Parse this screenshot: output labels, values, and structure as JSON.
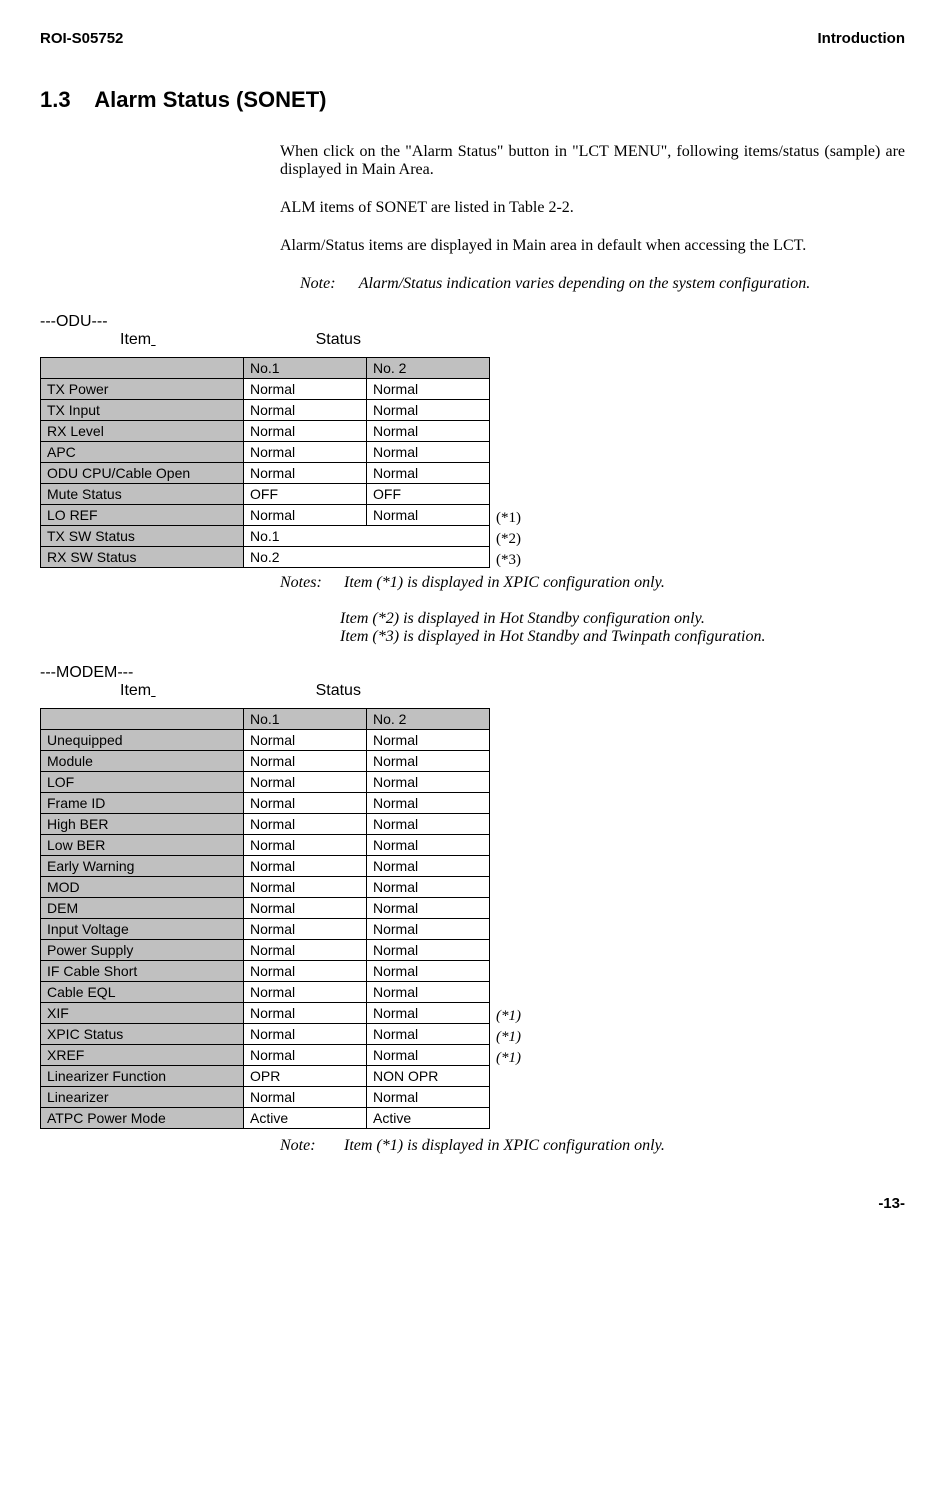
{
  "header": {
    "doc_id": "ROI-S05752",
    "section": "Introduction"
  },
  "title": {
    "num": "1.3",
    "text": "Alarm Status (SONET)"
  },
  "paras": {
    "p1": "When click on the \"Alarm Status\" button in \"LCT MENU\", following items/status (sample) are displayed in Main Area.",
    "p2": "ALM items of SONET are listed in Table 2-2.",
    "p3": "Alarm/Status items are displayed in Main area in default when accessing the LCT."
  },
  "note1": {
    "label": "Note:",
    "text": "Alarm/Status indication varies depending on the system configuration."
  },
  "labels": {
    "item": "Item",
    "status": "Status"
  },
  "odu": {
    "group": "---ODU---",
    "cols": {
      "c1": "No.1",
      "c2": "No. 2"
    },
    "rows": [
      {
        "name": "TX Power",
        "v1": "Normal",
        "v2": "Normal"
      },
      {
        "name": "TX Input",
        "v1": "Normal",
        "v2": "Normal"
      },
      {
        "name": "RX Level",
        "v1": "Normal",
        "v2": "Normal"
      },
      {
        "name": "APC",
        "v1": "Normal",
        "v2": "Normal"
      },
      {
        "name": "ODU CPU/Cable Open",
        "v1": "Normal",
        "v2": "Normal"
      },
      {
        "name": "Mute Status",
        "v1": "OFF",
        "v2": "OFF"
      },
      {
        "name": "LO REF",
        "v1": "Normal",
        "v2": "Normal",
        "annot": "(*1)"
      },
      {
        "name": "TX SW Status",
        "merged": "No.1",
        "annot": "(*2)"
      },
      {
        "name": "RX SW Status",
        "merged": "No.2",
        "annot": "(*3)"
      }
    ]
  },
  "odu_notes": {
    "label": "Notes:",
    "l1": "Item (*1) is displayed in XPIC configuration only.",
    "l2": "Item (*2) is displayed in Hot Standby configuration only.",
    "l3": "Item (*3) is displayed in Hot Standby and Twinpath configuration."
  },
  "modem": {
    "group": "---MODEM---",
    "cols": {
      "c1": "No.1",
      "c2": "No. 2"
    },
    "rows": [
      {
        "name": "Unequipped",
        "v1": "Normal",
        "v2": "Normal"
      },
      {
        "name": "Module",
        "v1": "Normal",
        "v2": "Normal"
      },
      {
        "name": "LOF",
        "v1": "Normal",
        "v2": "Normal"
      },
      {
        "name": "Frame ID",
        "v1": "Normal",
        "v2": "Normal"
      },
      {
        "name": "High BER",
        "v1": "Normal",
        "v2": "Normal"
      },
      {
        "name": "Low BER",
        "v1": "Normal",
        "v2": "Normal"
      },
      {
        "name": "Early Warning",
        "v1": "Normal",
        "v2": "Normal"
      },
      {
        "name": "MOD",
        "v1": "Normal",
        "v2": "Normal"
      },
      {
        "name": "DEM",
        "v1": "Normal",
        "v2": "Normal"
      },
      {
        "name": "Input Voltage",
        "v1": "Normal",
        "v2": "Normal"
      },
      {
        "name": "Power Supply",
        "v1": "Normal",
        "v2": "Normal"
      },
      {
        "name": "IF Cable Short",
        "v1": "Normal",
        "v2": "Normal"
      },
      {
        "name": "Cable EQL",
        "v1": "Normal",
        "v2": "Normal"
      },
      {
        "name": "XIF",
        "v1": "Normal",
        "v2": "Normal",
        "annot": "(*1)",
        "italic": true
      },
      {
        "name": "XPIC Status",
        "v1": "Normal",
        "v2": "Normal",
        "annot": "(*1)",
        "italic": true
      },
      {
        "name": "XREF",
        "v1": "Normal",
        "v2": "Normal",
        "annot": "(*1)",
        "italic": true
      },
      {
        "name": "Linearizer Function",
        "v1": "OPR",
        "v2": "NON OPR"
      },
      {
        "name": "Linearizer",
        "v1": "Normal",
        "v2": "Normal"
      },
      {
        "name": "ATPC Power Mode",
        "v1": "Active",
        "v2": "Active"
      }
    ]
  },
  "modem_note": {
    "label": "Note:",
    "text": "Item (*1) is displayed in XPIC configuration only."
  },
  "page_num": "-13-"
}
